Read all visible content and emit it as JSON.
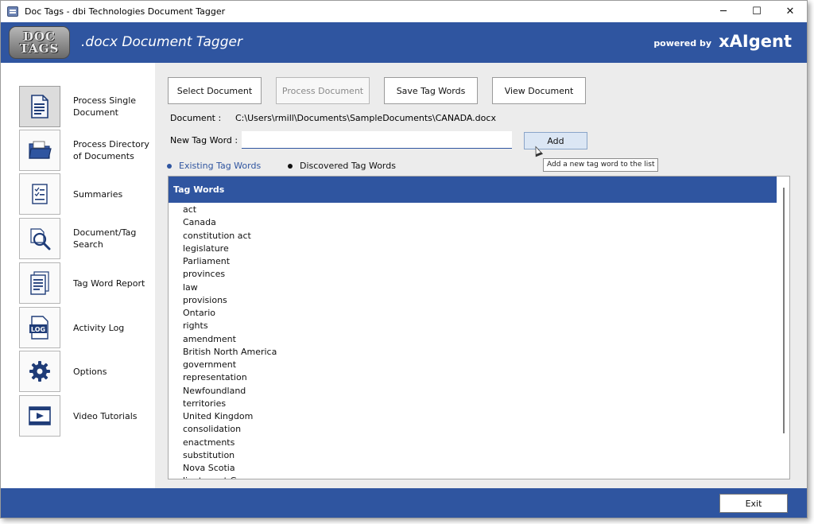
{
  "window": {
    "title": "Doc Tags - dbi Technologies Document Tagger",
    "minimize": "─",
    "maximize": "☐",
    "close": "✕"
  },
  "banner": {
    "logo_line1": "DOC",
    "logo_line2": "TAGS",
    "title": ".docx Document Tagger",
    "powered_by": "powered by",
    "brand": "xAIgent"
  },
  "sidebar": {
    "items": [
      {
        "label": "Process Single Document",
        "icon": "document-icon",
        "active": true
      },
      {
        "label": "Process Directory of Documents",
        "icon": "folder-icon",
        "active": false
      },
      {
        "label": "Summaries",
        "icon": "summary-icon",
        "active": false
      },
      {
        "label": "Document/Tag Search",
        "icon": "search-icon",
        "active": false
      },
      {
        "label": "Tag Word Report",
        "icon": "report-icon",
        "active": false
      },
      {
        "label": "Activity Log",
        "icon": "log-icon",
        "active": false
      },
      {
        "label": "Options",
        "icon": "gear-icon",
        "active": false
      },
      {
        "label": "Video Tutorials",
        "icon": "video-icon",
        "active": false
      }
    ],
    "log_icon_text": "LOG"
  },
  "toolbar": {
    "select_document": "Select Document",
    "process_document": "Process Document",
    "save_tag_words": "Save Tag Words",
    "view_document": "View Document"
  },
  "document": {
    "label": "Document :",
    "path": "C:\\Users\\rmill\\Documents\\SampleDocuments\\CANADA.docx"
  },
  "new_tag": {
    "label": "New Tag Word :",
    "value": "",
    "add_button": "Add",
    "tooltip": "Add a new tag word to the list"
  },
  "view_options": {
    "existing": "Existing Tag Words",
    "discovered": "Discovered Tag Words",
    "selected": "existing"
  },
  "tag_list": {
    "header": "Tag Words",
    "items": [
      "act",
      "Canada",
      "constitution act",
      "legislature",
      "Parliament",
      "provinces",
      "law",
      "provisions",
      "Ontario",
      "rights",
      "amendment",
      "British North America",
      "government",
      "representation",
      "Newfoundland",
      "territories",
      "United Kingdom",
      "consolidation",
      "enactments",
      "substitution",
      "Nova Scotia",
      "lieutenant Governor"
    ]
  },
  "footer": {
    "exit": "Exit"
  },
  "colors": {
    "brand_blue": "#2f55a0",
    "add_button_bg": "#dbe6f4"
  }
}
